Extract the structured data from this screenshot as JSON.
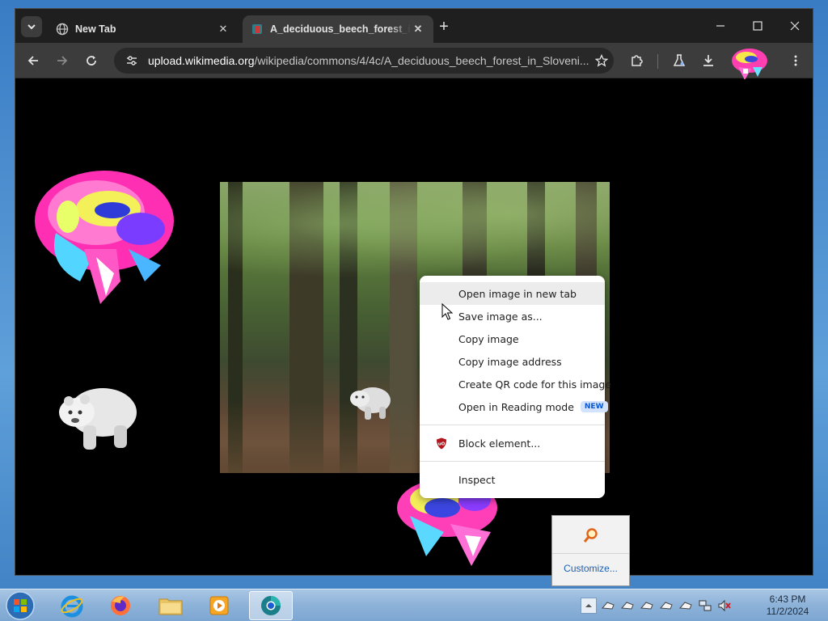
{
  "browser": {
    "tabs": [
      {
        "title": "New Tab",
        "active": false
      },
      {
        "title": "A_deciduous_beech_forest_in_Slovenia",
        "active": true
      }
    ],
    "url": {
      "host": "upload.wikimedia.org",
      "path": "/wikipedia/commons/4/4c/A_deciduous_beech_forest_in_Sloveni..."
    }
  },
  "context_menu": {
    "items": [
      {
        "label": "Open image in new tab",
        "hover": true
      },
      {
        "label": "Save image as..."
      },
      {
        "label": "Copy image"
      },
      {
        "label": "Copy image address"
      },
      {
        "label": "Create QR code for this image"
      },
      {
        "label": "Open in Reading mode",
        "badge": "NEW"
      },
      {
        "label": "Block element..."
      },
      {
        "label": "Inspect"
      }
    ]
  },
  "tray_popup": {
    "customize_label": "Customize..."
  },
  "taskbar": {
    "apps": [
      "internet-explorer",
      "firefox",
      "file-explorer",
      "media-player",
      "chrome-beta"
    ],
    "clock": {
      "time": "6:43 PM",
      "date": "11/2/2024"
    }
  },
  "colors": {
    "tabstrip": "#1f1f1f",
    "toolbar": "#3c3c3c",
    "menu_badge": "#d3e3fd",
    "customize_link": "#1a5fb4"
  }
}
